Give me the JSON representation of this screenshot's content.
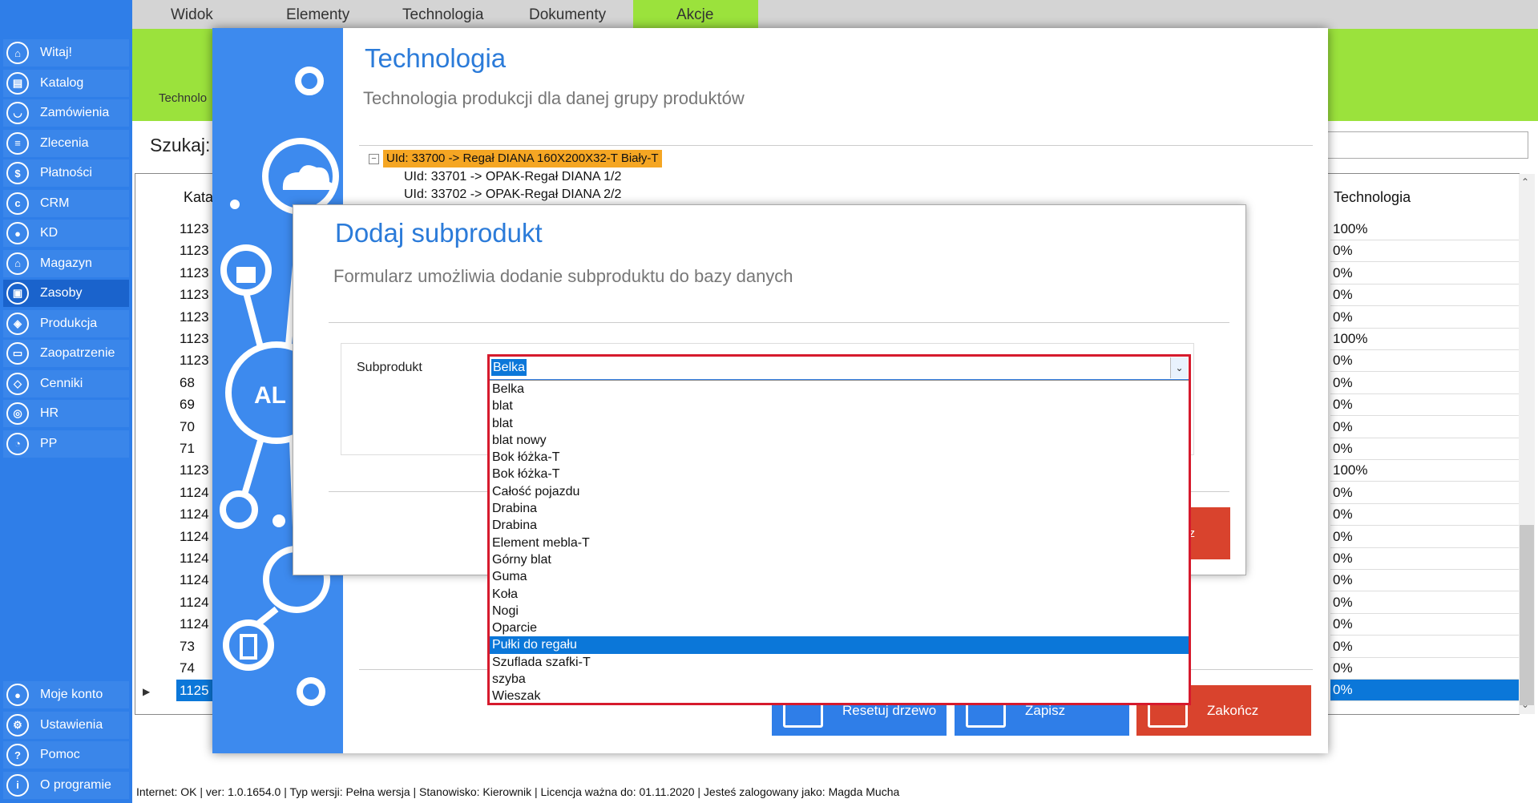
{
  "ribbon": {
    "tabs": [
      "Widok",
      "Elementy",
      "Technologia",
      "Dokumenty",
      "Akcje"
    ],
    "group_label": "Technolo"
  },
  "sidebar": {
    "items": [
      {
        "label": "Witaj!",
        "icon": "home-icon"
      },
      {
        "label": "Katalog",
        "icon": "book-icon"
      },
      {
        "label": "Zamówienia",
        "icon": "cart-icon"
      },
      {
        "label": "Zlecenia",
        "icon": "list-icon"
      },
      {
        "label": "Płatności",
        "icon": "dollar-icon"
      },
      {
        "label": "CRM",
        "icon": "crm-icon"
      },
      {
        "label": "KD",
        "icon": "person-icon"
      },
      {
        "label": "Magazyn",
        "icon": "warehouse-icon"
      },
      {
        "label": "Zasoby",
        "icon": "box-icon"
      },
      {
        "label": "Produkcja",
        "icon": "production-icon"
      },
      {
        "label": "Zaopatrzenie",
        "icon": "truck-icon"
      },
      {
        "label": "Cenniki",
        "icon": "tag-icon"
      },
      {
        "label": "HR",
        "icon": "hr-icon"
      },
      {
        "label": "PP",
        "icon": "chart-icon"
      }
    ],
    "bottom_items": [
      {
        "label": "Moje konto",
        "icon": "user-icon"
      },
      {
        "label": "Ustawienia",
        "icon": "gear-icon"
      },
      {
        "label": "Pomoc",
        "icon": "help-icon"
      },
      {
        "label": "O programie",
        "icon": "info-icon"
      }
    ],
    "active": "Zasoby"
  },
  "search": {
    "label": "Szukaj:"
  },
  "grid": {
    "col_kat": "Kata",
    "col_tech": "Technologia",
    "kat_values": [
      "1123",
      "1123",
      "1123",
      "1123",
      "1123",
      "1123",
      "1123",
      "68",
      "69",
      "70",
      "71",
      "1123",
      "1124",
      "1124",
      "1124",
      "1124",
      "1124",
      "1124",
      "1124",
      "73",
      "74",
      "1125"
    ],
    "tech_values": [
      "100%",
      "0%",
      "0%",
      "0%",
      "0%",
      "100%",
      "0%",
      "0%",
      "0%",
      "0%",
      "0%",
      "100%",
      "0%",
      "0%",
      "0%",
      "0%",
      "0%",
      "0%",
      "0%",
      "0%",
      "0%",
      "0%"
    ]
  },
  "tech_dialog": {
    "title": "Technologia",
    "subtitle": "Technologia produkcji dla danej grupy produktów",
    "tree": {
      "root": "UId: 33700 -> Regał DIANA 160X200X32-T Biały-T",
      "children": [
        "UId: 33701 -> OPAK-Regał DIANA   1/2",
        "UId: 33702 -> OPAK-Regał DIANA   2/2"
      ]
    },
    "buttons": {
      "reset": "Resetuj drzewo",
      "save": "Zapisz",
      "end": "Zakończ"
    },
    "side_logo": "AL ER"
  },
  "sub_dialog": {
    "title": "Dodaj subprodukt",
    "description": "Formularz umożliwia dodanie subproduktu do bazy danych",
    "field_label": "Subprodukt",
    "selected_value": "Belka",
    "partial_button": "z",
    "options": [
      "Belka",
      "blat",
      "blat",
      "blat nowy",
      "Bok łóżka-T",
      "Bok łóżka-T",
      "Całość pojazdu",
      "Drabina",
      "Drabina",
      "Element mebla-T",
      "Górny blat",
      "Guma",
      "Koła",
      "Nogi",
      "Oparcie",
      "Pułki do regału",
      "Szuflada szafki-T",
      "szyba",
      "Wieszak"
    ],
    "highlighted_option": "Pułki do regału"
  },
  "statusbar": {
    "text": "Internet: OK  |   ver: 1.0.1654.0   |   Typ wersji: Pełna wersja   |   Stanowisko: Kierownik   |   Licencja ważna do: 01.11.2020   |   Jesteś zalogowany jako: Magda Mucha"
  },
  "colors": {
    "accent": "#2f7ee8",
    "ribbon": "#9be23c",
    "danger": "#d9432d",
    "selection": "#0b77d9",
    "tree_highlight": "#f5a623"
  }
}
